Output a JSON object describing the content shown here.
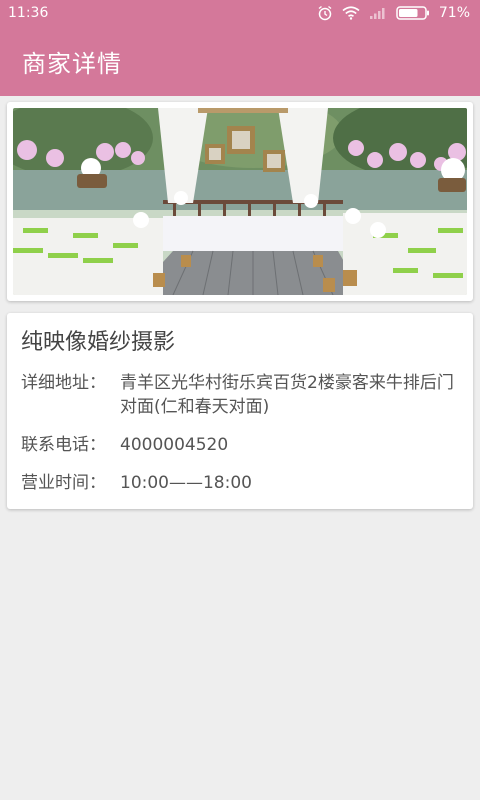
{
  "status_bar": {
    "time": "11:36",
    "battery": "71%",
    "icons": [
      "alarm-icon",
      "wifi-icon",
      "signal-icon",
      "battery-icon"
    ]
  },
  "app_bar": {
    "title": "商家详情",
    "color": "#d4789a"
  },
  "merchant": {
    "photo": "wedding-venue-photo",
    "name": "纯映像婚纱摄影",
    "address_label": "详细地址：",
    "address": "青羊区光华村街乐宾百货2楼豪客来牛排后门对面(仁和春天对面)",
    "phone_label": "联系电话：",
    "phone": "4000004520",
    "hours_label": "营业时间：",
    "hours": "10:00——18:00"
  }
}
